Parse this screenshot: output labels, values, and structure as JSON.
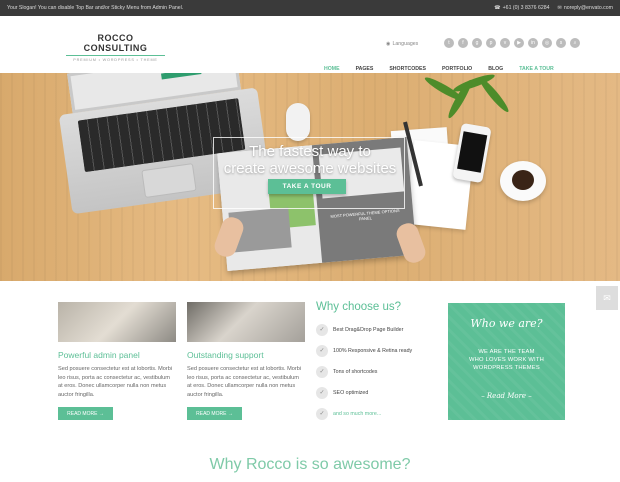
{
  "topbar": {
    "slogan": "Your Slogan! You can disable Top Bar and/or Sticky Menu from Admin Panel.",
    "phone": "+61 (0) 3 8376 6284",
    "email": "noreply@envato.com"
  },
  "header": {
    "logo_name": "ROCCO CONSULTING",
    "logo_tagline": "PREMIUM • WORDPRESS • THEME",
    "languages_label": "Languages",
    "social_icons": [
      "twitter-icon",
      "facebook-icon",
      "google-plus-icon",
      "pinterest-icon",
      "vimeo-icon",
      "youtube-icon",
      "linkedin-icon",
      "dribbble-icon",
      "skype-icon",
      "search-icon"
    ],
    "social_glyphs": [
      "t",
      "f",
      "g",
      "p",
      "v",
      "▶",
      "in",
      "◎",
      "s",
      "⌕"
    ]
  },
  "nav": {
    "items": [
      {
        "label": "HOME"
      },
      {
        "label": "PAGES"
      },
      {
        "label": "SHORTCODES"
      },
      {
        "label": "PORTFOLIO"
      },
      {
        "label": "BLOG"
      },
      {
        "label": "TAKE A TOUR"
      }
    ]
  },
  "hero": {
    "title_line1": "The fastest way to",
    "title_line2": "create awesome websites",
    "button_label": "TAKE A TOUR",
    "brochure_text": "MOST POWERFUL THEME OPTIONS PANEL"
  },
  "features": [
    {
      "title": "Powerful admin panel",
      "text": "Sed posuere consectetur est at lobortis. Morbi leo risus, porta ac consectetur ac, vestibulum at eros. Donec ullamcorper nulla non metus auctor fringilla.",
      "button": "READ MORE →"
    },
    {
      "title": "Outstanding support",
      "text": "Sed posuere consectetur est at lobortis. Morbi leo risus, porta ac consectetur ac, vestibulum at eros. Donec ullamcorper nulla non metus auctor fringilla.",
      "button": "READ MORE →"
    }
  ],
  "why": {
    "title": "Why choose us?",
    "items": [
      "Best Drag&Drop Page Builder",
      "100% Responsive & Retina ready",
      "Tons of shortcodes",
      "SEO optimized",
      "and so much more..."
    ]
  },
  "who": {
    "title": "Who we are?",
    "line1": "WE ARE THE TEAM",
    "line2": "WHO LOVES WORK WITH",
    "line3": "WORDPRESS THEMES",
    "more": "– Read More –"
  },
  "section_title": "Why Rocco is so awesome?",
  "colors": {
    "accent": "#5cbf96",
    "topbar": "#3a3a3a"
  }
}
